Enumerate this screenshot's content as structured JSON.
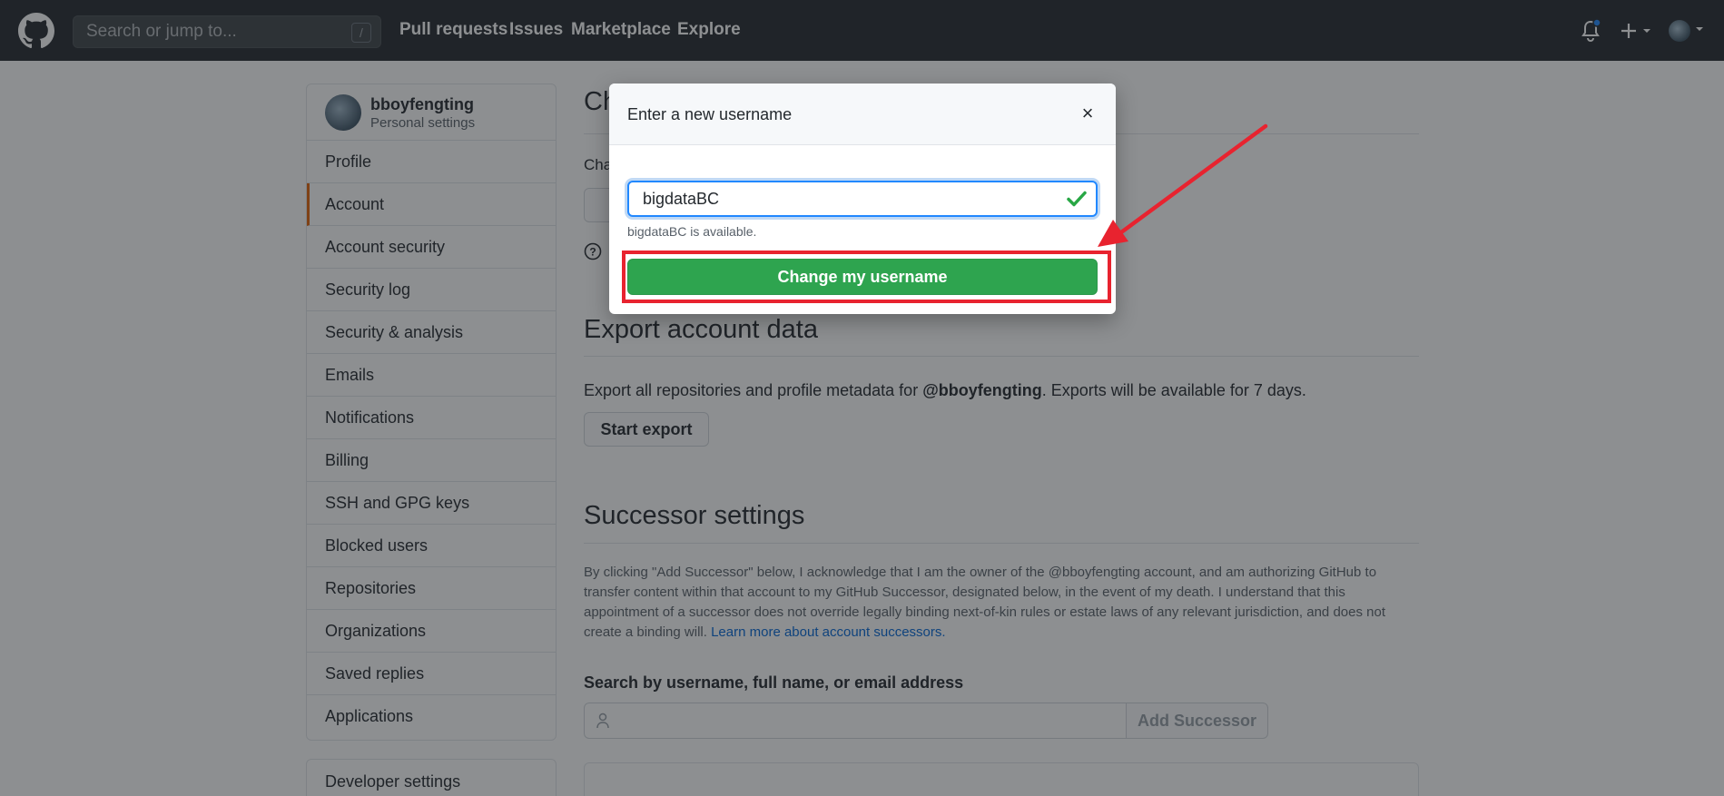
{
  "header": {
    "search_placeholder": "Search or jump to...",
    "search_shortcut": "/",
    "nav": [
      "Pull requests",
      "Issues",
      "Marketplace",
      "Explore"
    ],
    "icons": [
      "github-logo-icon",
      "bell-icon",
      "plus-icon",
      "avatar-icon"
    ]
  },
  "sidebar": {
    "username": "bboyfengting",
    "subtitle": "Personal settings",
    "items": [
      {
        "label": "Profile"
      },
      {
        "label": "Account"
      },
      {
        "label": "Account security"
      },
      {
        "label": "Security log"
      },
      {
        "label": "Security & analysis"
      },
      {
        "label": "Emails"
      },
      {
        "label": "Notifications"
      },
      {
        "label": "Billing"
      },
      {
        "label": "SSH and GPG keys"
      },
      {
        "label": "Blocked users"
      },
      {
        "label": "Repositories"
      },
      {
        "label": "Organizations"
      },
      {
        "label": "Saved replies"
      },
      {
        "label": "Applications"
      }
    ],
    "developer_settings": "Developer settings"
  },
  "main": {
    "change_title_partial": "Ch",
    "change_text_partial": "Cha",
    "export_title": "Export account data",
    "export_text_pre": "Export all repositories and profile metadata for ",
    "export_text_user": "@bboyfengting",
    "export_text_post": ". Exports will be available for 7 days.",
    "export_button": "Start export",
    "successor_title": "Successor settings",
    "successor_para": "By clicking \"Add Successor\" below, I acknowledge that I am the owner of the @bboyfengting account, and am authorizing GitHub to transfer content within that account to my GitHub Successor, designated below, in the event of my death. I understand that this appointment of a successor does not override legally binding next-of-kin rules or estate laws of any relevant jurisdiction, and does not create a binding will. ",
    "successor_link": "Learn more about account successors.",
    "search_label": "Search by username, full name, or email address",
    "add_successor": "Add Successor"
  },
  "modal": {
    "title": "Enter a new username",
    "close": "×",
    "input_value": "bigdataBC",
    "availability": "bigdataBC is available.",
    "submit": "Change my username"
  },
  "colors": {
    "header_bg": "#24292e",
    "primary_button": "#2ea44f",
    "focus_ring": "#2188ff",
    "annotation": "#e8232f",
    "active_marker": "#e36209"
  }
}
